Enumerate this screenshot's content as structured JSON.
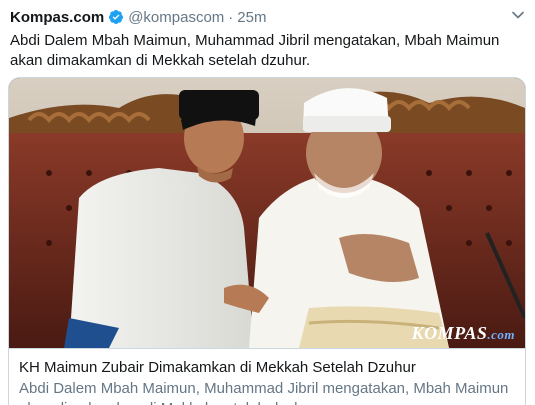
{
  "tweet": {
    "display_name": "Kompas.com",
    "handle": "@kompascom",
    "separator": "·",
    "time": "25m",
    "text": "Abdi Dalem Mbah Maimun, Muhammad Jibril mengatakan, Mbah Maimun akan dimakamkan di Mekkah setelah dzuhur."
  },
  "card": {
    "watermark_brand": "KOMPAS",
    "watermark_suffix": ".com",
    "title": "KH Maimun Zubair Dimakamkan di Mekkah Setelah Dzuhur",
    "description": "Abdi Dalem Mbah Maimun, Muhammad Jibril mengatakan, Mbah Maimun akan dimakamkan di Mekkah setelah dzuhur."
  },
  "colors": {
    "verified": "#1da1f2",
    "secondary_text": "#657786",
    "border": "#ccd6dd"
  },
  "icons": {
    "verified": "verified-badge-icon",
    "menu": "chevron-down-icon"
  }
}
